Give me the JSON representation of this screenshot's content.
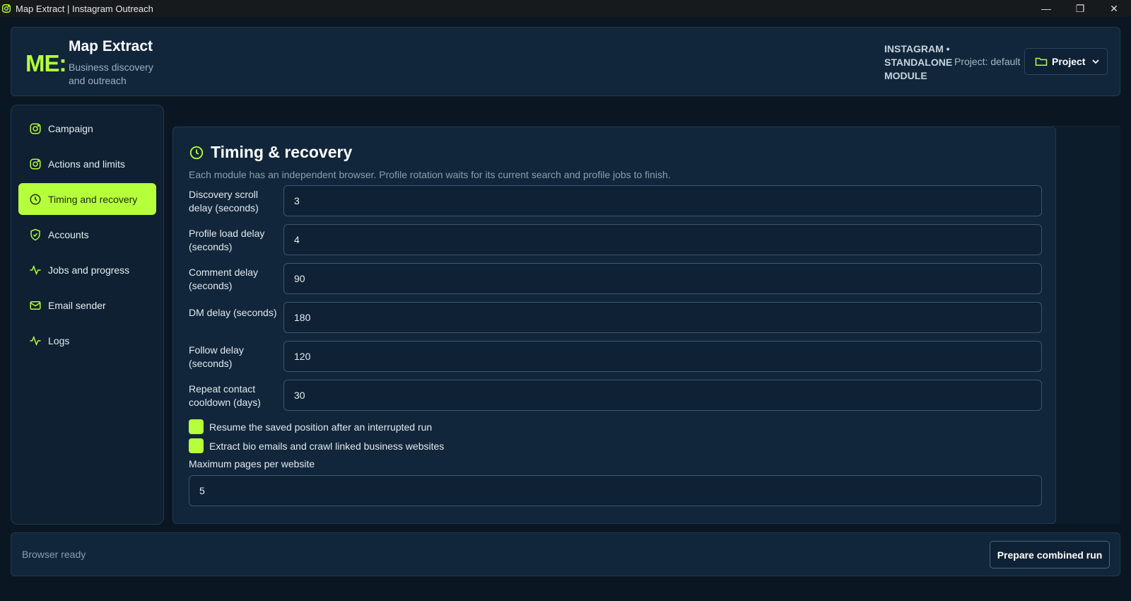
{
  "window": {
    "title": "Map Extract | Instagram Outreach",
    "controls": {
      "minimize": "—",
      "restore": "❐",
      "close": "✕"
    }
  },
  "header": {
    "brand_mark": "ME:",
    "brand_title": "Map Extract",
    "brand_subtitle": "Business discovery and outreach",
    "module_label": "INSTAGRAM • STANDALONE MODULE",
    "project_text": "Project: default",
    "project_button": "Project"
  },
  "sidebar": {
    "items": [
      {
        "label": "Campaign",
        "icon": "instagram-icon",
        "active": false
      },
      {
        "label": "Actions and limits",
        "icon": "instagram-icon",
        "active": false
      },
      {
        "label": "Timing and recovery",
        "icon": "clock-icon",
        "active": true
      },
      {
        "label": "Accounts",
        "icon": "shield-check-icon",
        "active": false
      },
      {
        "label": "Jobs and progress",
        "icon": "activity-icon",
        "active": false
      },
      {
        "label": "Email sender",
        "icon": "mail-icon",
        "active": false
      },
      {
        "label": "Logs",
        "icon": "activity-icon",
        "active": false
      }
    ]
  },
  "panel": {
    "title": "Timing & recovery",
    "description": "Each module has an independent browser. Profile rotation waits for its current search and profile jobs to finish.",
    "fields": [
      {
        "label": "Discovery scroll delay (seconds)",
        "value": "3"
      },
      {
        "label": "Profile load delay (seconds)",
        "value": "4"
      },
      {
        "label": "Comment delay (seconds)",
        "value": "90"
      },
      {
        "label": "DM delay (seconds)",
        "value": "180"
      },
      {
        "label": "Follow delay (seconds)",
        "value": "120"
      },
      {
        "label": "Repeat contact cooldown (days)",
        "value": "30"
      }
    ],
    "checkboxes": [
      {
        "label": "Resume the saved position after an interrupted run",
        "checked": true
      },
      {
        "label": "Extract bio emails and crawl linked business websites",
        "checked": true
      }
    ],
    "max_pages_label": "Maximum pages per website",
    "max_pages_value": "5"
  },
  "footer": {
    "status": "Browser ready",
    "run_button": "Prepare combined run"
  },
  "colors": {
    "accent": "#b6ff3b",
    "background": "#0a1722",
    "card": "#11263a"
  }
}
